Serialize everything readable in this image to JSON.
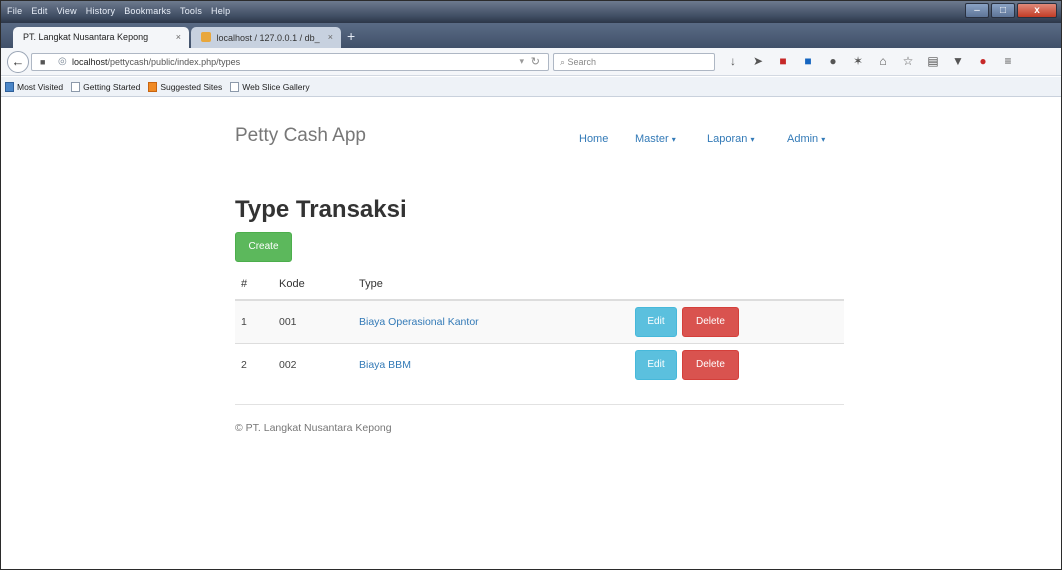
{
  "browser": {
    "menu": [
      "File",
      "Edit",
      "View",
      "History",
      "Bookmarks",
      "Tools",
      "Help"
    ],
    "tabs": [
      {
        "label": "PT. Langkat Nusantara Kepong",
        "active": true
      },
      {
        "label": "localhost / 127.0.0.1 / db_",
        "active": false
      }
    ],
    "url_prefix": "localhost",
    "url_rest": "/pettycash/public/index.php/types",
    "search_placeholder": "Search",
    "bookmarks": [
      "Most Visited",
      "Getting Started",
      "Suggested Sites",
      "Web Slice Gallery"
    ]
  },
  "app": {
    "brand": "Petty Cash App",
    "nav": [
      {
        "label": "Home",
        "dropdown": false
      },
      {
        "label": "Master",
        "dropdown": true
      },
      {
        "label": "Laporan",
        "dropdown": true
      },
      {
        "label": "Admin",
        "dropdown": true
      }
    ],
    "title": "Type Transaksi",
    "create_label": "Create",
    "table": {
      "headers": [
        "#",
        "Kode",
        "Type"
      ],
      "rows": [
        {
          "num": "1",
          "kode": "001",
          "type": "Biaya Operasional Kantor"
        },
        {
          "num": "2",
          "kode": "002",
          "type": "Biaya BBM"
        }
      ],
      "edit_label": "Edit",
      "delete_label": "Delete"
    },
    "footer": "© PT. Langkat Nusantara Kepong"
  },
  "colors": {
    "link": "#337ab7",
    "success": "#5cb85c",
    "info": "#5bc0de",
    "danger": "#d9534f"
  }
}
